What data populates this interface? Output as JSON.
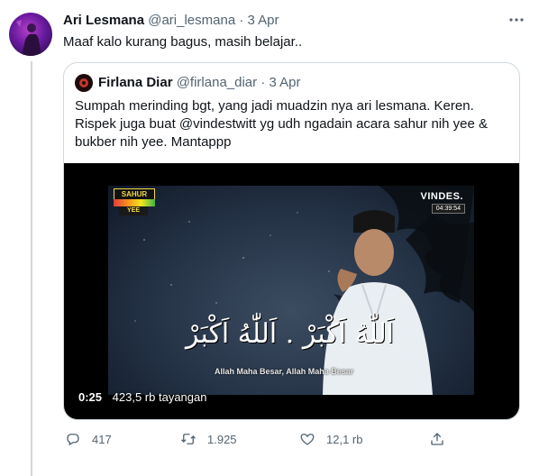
{
  "tweet": {
    "author_name": "Ari Lesmana",
    "author_handle": "@ari_lesmana",
    "separator": "·",
    "date": "3 Apr",
    "text": "Maaf kalo kurang bagus, masih belajar..",
    "more_icon": "more-horizontal-icon"
  },
  "quote": {
    "author_name": "Firlana Diar",
    "author_handle": "@firlana_diar",
    "separator": "·",
    "date": "3 Apr",
    "text_lines": [
      "Sumpah merinding bgt, yang jadi muadzin nya ari lesmana. Keren.",
      "Rispek juga buat @vindestwitt yg udh ngadain acara sahur nih yee &",
      "bukber nih yee. Mantappp"
    ]
  },
  "video": {
    "badge_top": "SAHUR",
    "badge_bottom": "YEE",
    "brand": "VINDES.",
    "on_screen_time": "04:39:54",
    "arabic_caption": "اَللّٰهُ اَكْبَرْ . اَللّٰهُ اَكْبَرْ",
    "subtitle": "Allah Maha Besar, Allah Maha Besar",
    "elapsed": "0:25",
    "views": "423,5 rb tayangan"
  },
  "actions": {
    "reply_count": "417",
    "retweet_count": "1.925",
    "like_count": "12,1 rb",
    "reply_icon": "reply-icon",
    "retweet_icon": "retweet-icon",
    "like_icon": "heart-icon",
    "share_icon": "share-icon"
  },
  "colors": {
    "secondary_text": "#536471",
    "border": "#cfd9de",
    "primary_text": "#0f1419"
  }
}
